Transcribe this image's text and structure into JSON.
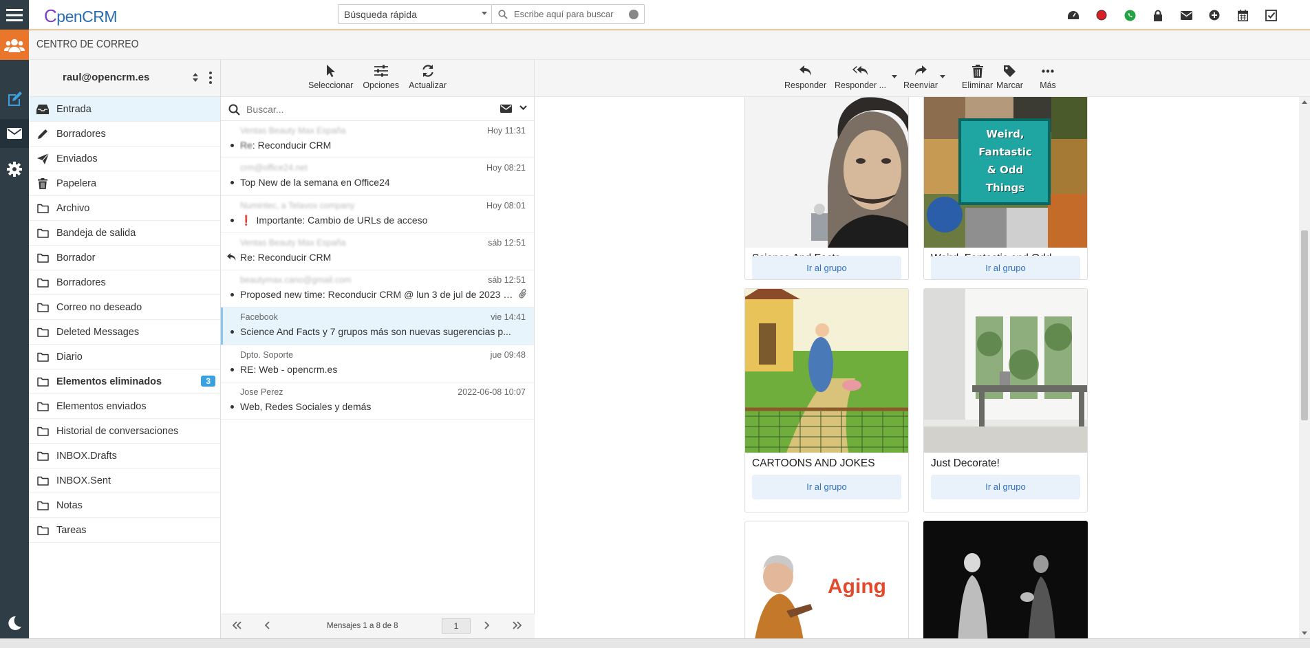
{
  "app": {
    "logo_c": "C",
    "logo_rest": "penCRM"
  },
  "quick_search": {
    "select_value": "Búsqueda rápida",
    "placeholder": "Escribe aquí para buscar"
  },
  "top_icons": [
    "dashboard-icon",
    "record-icon",
    "whatsapp-icon",
    "lock-icon",
    "mail-icon",
    "add-icon",
    "calendar-icon",
    "tasks-icon"
  ],
  "subbar": {
    "title": "CENTRO DE CORREO"
  },
  "account": {
    "email": "raul@opencrm.es"
  },
  "folders": [
    {
      "label": "Entrada",
      "icon": "inbox-icon",
      "active": true
    },
    {
      "label": "Borradores",
      "icon": "pencil-icon"
    },
    {
      "label": "Enviados",
      "icon": "send-icon"
    },
    {
      "label": "Papelera",
      "icon": "trash-icon"
    },
    {
      "label": "Archivo",
      "icon": "folder-icon"
    },
    {
      "label": "Bandeja de salida",
      "icon": "folder-icon"
    },
    {
      "label": "Borrador",
      "icon": "folder-icon"
    },
    {
      "label": "Borradores",
      "icon": "folder-icon"
    },
    {
      "label": "Correo no deseado",
      "icon": "folder-icon"
    },
    {
      "label": "Deleted Messages",
      "icon": "folder-icon"
    },
    {
      "label": "Diario",
      "icon": "folder-icon"
    },
    {
      "label": "Elementos eliminados",
      "icon": "folder-icon",
      "bold": true,
      "badge": "3"
    },
    {
      "label": "Elementos enviados",
      "icon": "folder-icon"
    },
    {
      "label": "Historial de conversaciones",
      "icon": "folder-icon"
    },
    {
      "label": "INBOX.Drafts",
      "icon": "folder-icon"
    },
    {
      "label": "INBOX.Sent",
      "icon": "folder-icon"
    },
    {
      "label": "Notas",
      "icon": "folder-icon"
    },
    {
      "label": "Tareas",
      "icon": "folder-icon"
    }
  ],
  "list_toolbar": {
    "select": "Seleccionar",
    "options": "Opciones",
    "refresh": "Actualizar"
  },
  "list_search": {
    "placeholder": "Buscar..."
  },
  "messages": [
    {
      "from": "Ventas Beauty Max España",
      "blur": true,
      "date": "Hoy 11:31",
      "subject_prefix": "Re",
      "subject": ": Reconducir CRM"
    },
    {
      "from": "crm@office24.net",
      "blur": true,
      "date": "Hoy 08:21",
      "subject": "Top New de la semana en Office24"
    },
    {
      "from": "Numintec, a Telavox company",
      "blur": true,
      "date": "Hoy 08:01",
      "important": "❗",
      "subject": "Importante: Cambio de URLs de acceso"
    },
    {
      "from": "Ventas Beauty Max España",
      "blur": true,
      "date": "sáb 12:51",
      "replied": true,
      "subject": "Re: Reconducir CRM"
    },
    {
      "from": "beautymax.cano@gmail.com",
      "blur": true,
      "date": "sáb 12:51",
      "attachment": true,
      "subject": "Proposed new time: Reconducir CRM @ lun 3 de jul de 2023 1..."
    },
    {
      "from": "Facebook",
      "date": "vie 14:41",
      "selected": true,
      "subject": "Science And Facts y 7 grupos más son nuevas sugerencias p..."
    },
    {
      "from": "Dpto. Soporte",
      "date": "jue 09:48",
      "subject": "RE: Web - opencrm.es"
    },
    {
      "from": "Jose Perez",
      "date": "2022-06-08 10:07",
      "subject": "Web, Redes Sociales y demás"
    }
  ],
  "pager": {
    "info": "Mensajes 1 a 8 de 8",
    "page": "1"
  },
  "reader_toolbar": {
    "reply": "Responder",
    "reply_all": "Responder ...",
    "forward": "Reenviar",
    "delete": "Eliminar",
    "flag": "Marcar",
    "more": "Más"
  },
  "groups": [
    {
      "title": "Science And Facts",
      "button": "Ir al grupo"
    },
    {
      "title": "Weird, Fantastic and Odd Things",
      "button": "Ir al grupo",
      "image_text": [
        "Weird,",
        "Fantastic",
        "& Odd",
        "Things"
      ]
    },
    {
      "title": "CARTOONS AND JOKES",
      "button": "Ir al grupo"
    },
    {
      "title": "Just Decorate!",
      "button": "Ir al grupo"
    },
    {
      "title": "",
      "image_text": [
        "Aging"
      ]
    },
    {
      "title": ""
    }
  ],
  "colors": {
    "accent": "#e9762b",
    "rail": "#2f3e46",
    "link": "#2f6fbf",
    "badge": "#3aa0e0"
  }
}
